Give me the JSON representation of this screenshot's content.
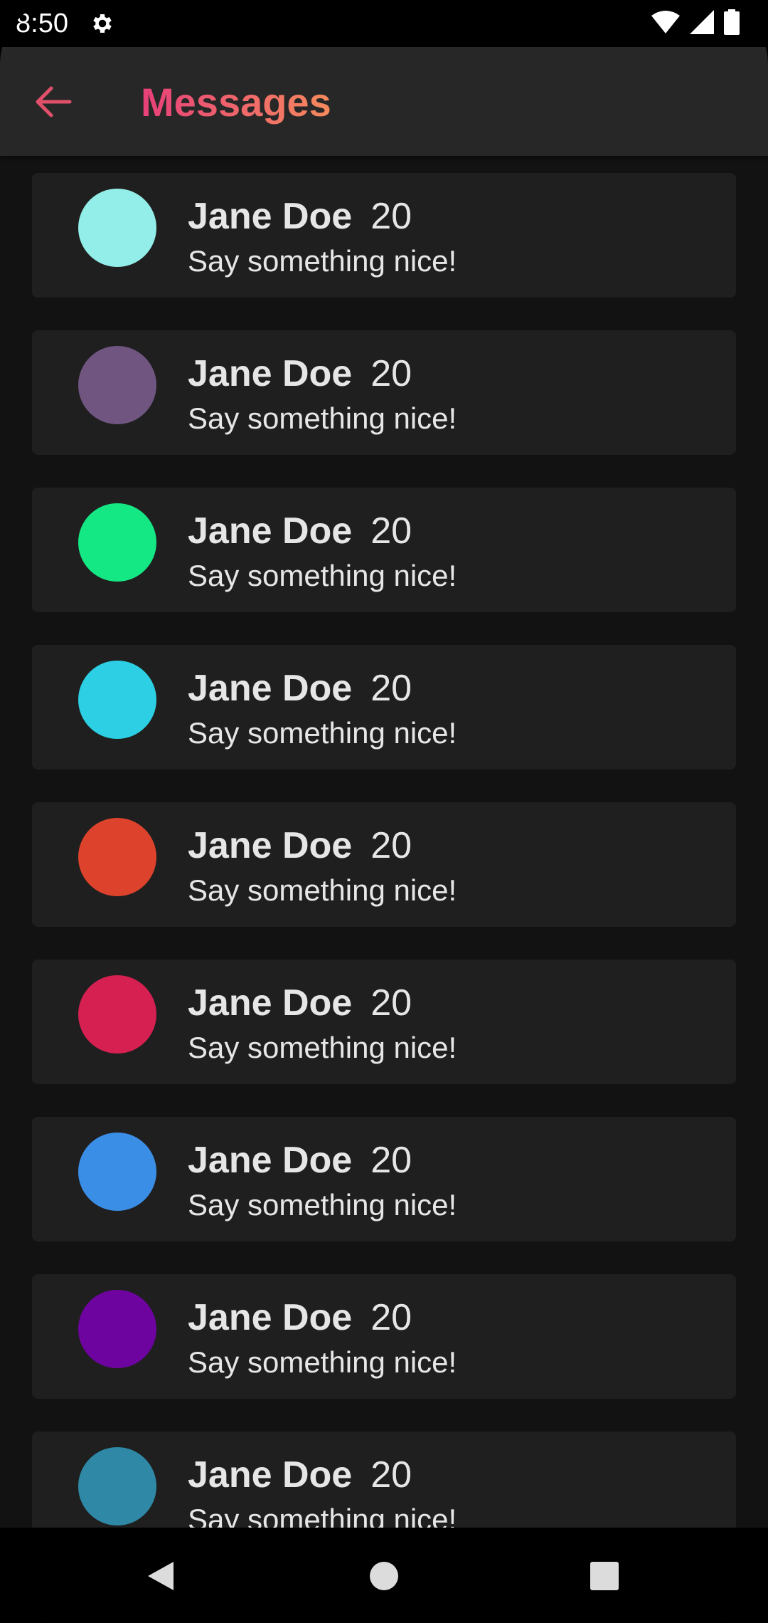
{
  "status_bar": {
    "time": "8:50",
    "icons": [
      "settings-gear-icon",
      "wifi-icon",
      "cellular-signal-icon",
      "battery-icon"
    ]
  },
  "app_bar": {
    "back_icon": "arrow-left-icon",
    "title": "Messages",
    "title_gradient": [
      "#e8407a",
      "#f58a5c"
    ],
    "back_color": "#e0506a"
  },
  "messages": [
    {
      "name": "Jane Doe",
      "age": "20",
      "text": "Say something nice!",
      "avatar_color": "#93ede8"
    },
    {
      "name": "Jane Doe",
      "age": "20",
      "text": "Say something nice!",
      "avatar_color": "#6f5580"
    },
    {
      "name": "Jane Doe",
      "age": "20",
      "text": "Say something nice!",
      "avatar_color": "#14e884"
    },
    {
      "name": "Jane Doe",
      "age": "20",
      "text": "Say something nice!",
      "avatar_color": "#2ccfe3"
    },
    {
      "name": "Jane Doe",
      "age": "20",
      "text": "Say something nice!",
      "avatar_color": "#dd432c"
    },
    {
      "name": "Jane Doe",
      "age": "20",
      "text": "Say something nice!",
      "avatar_color": "#d52051"
    },
    {
      "name": "Jane Doe",
      "age": "20",
      "text": "Say something nice!",
      "avatar_color": "#3a8ee6"
    },
    {
      "name": "Jane Doe",
      "age": "20",
      "text": "Say something nice!",
      "avatar_color": "#6e04a0"
    },
    {
      "name": "Jane Doe",
      "age": "20",
      "text": "Say something nice!",
      "avatar_color": "#2e88a6"
    }
  ],
  "nav_bar": {
    "icons": [
      "back-triangle-icon",
      "home-circle-icon",
      "recents-square-icon"
    ]
  }
}
